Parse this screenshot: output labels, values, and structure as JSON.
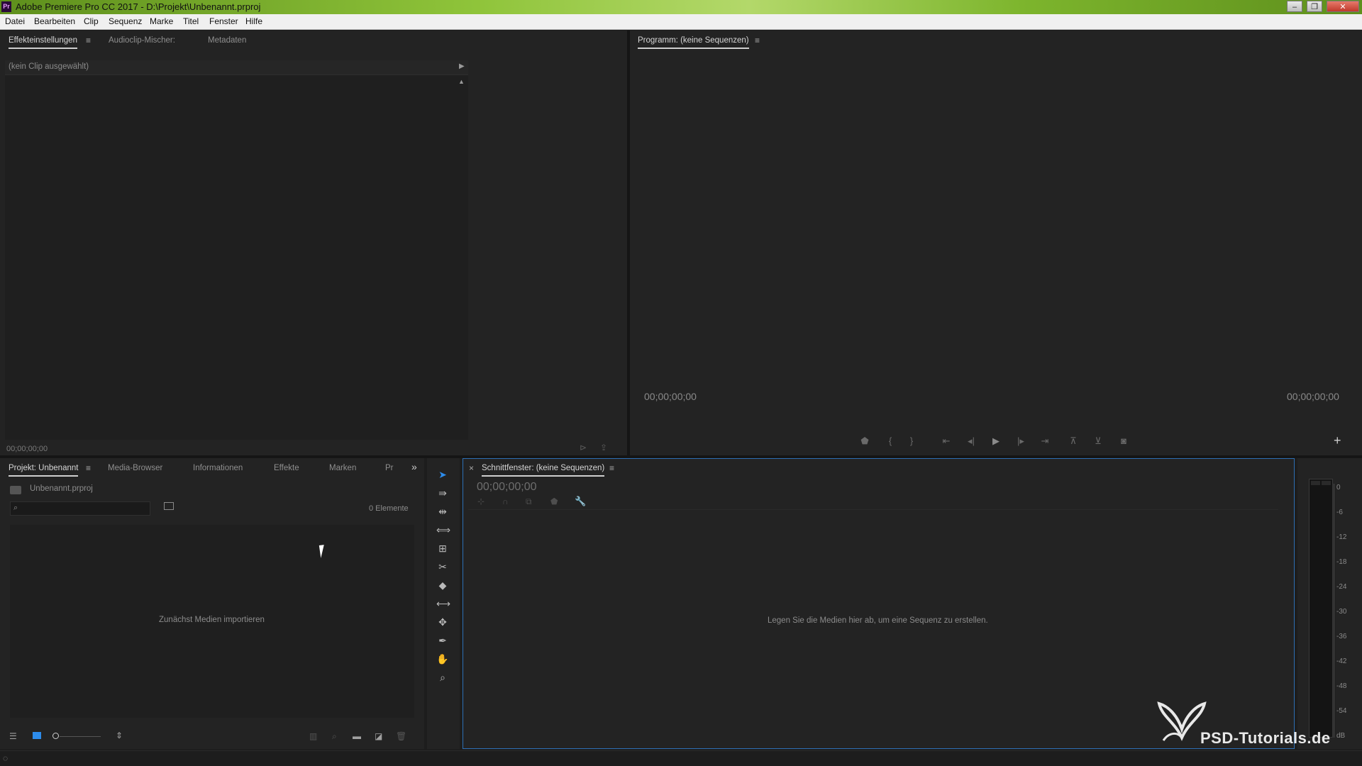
{
  "window": {
    "app_icon": "Pr",
    "title": "Adobe Premiere Pro CC 2017 - D:\\Projekt\\Unbenannt.prproj",
    "minimize_glyph": "–",
    "maximize_glyph": "❐",
    "close_glyph": "✕"
  },
  "menu": [
    "Datei",
    "Bearbeiten",
    "Clip",
    "Sequenz",
    "Marke",
    "Titel",
    "Fenster",
    "Hilfe"
  ],
  "effects_panel": {
    "tabs": [
      "Effekteinstellungen",
      "Audioclip-Mischer:",
      "Metadaten"
    ],
    "menu_glyph": "≡",
    "no_clip": "(kein Clip ausgewählt)",
    "timecode": "00;00;00;00"
  },
  "program_monitor": {
    "title": "Programm: (keine Sequenzen)",
    "menu_glyph": "≡",
    "timecode_left": "00;00;00;00",
    "timecode_right": "00;00;00;00",
    "add_glyph": "+",
    "controls": [
      "marker-icon",
      "mark-in-icon",
      "mark-out-icon",
      "go-to-in-icon",
      "step-back-icon",
      "play-icon",
      "step-forward-icon",
      "go-to-out-icon",
      "lift-icon",
      "extract-icon",
      "camera-icon"
    ]
  },
  "project_panel": {
    "tabs": [
      "Projekt: Unbenannt",
      "Media-Browser",
      "Informationen",
      "Effekte",
      "Marken",
      "Pr"
    ],
    "menu_glyph": "≡",
    "overflow_glyph": "»",
    "file_name": "Unbenannt.prproj",
    "search_placeholder": "",
    "item_count": "0 Elemente",
    "empty_message": "Zunächst Medien importieren"
  },
  "tools": [
    "selection-tool",
    "track-select-tool",
    "ripple-edit-tool",
    "rolling-edit-tool",
    "rate-stretch-tool",
    "razor-tool",
    "slip-tool",
    "slide-tool",
    "pen-tool",
    "hand-tool",
    "zoom-tool"
  ],
  "timeline": {
    "close_glyph": "×",
    "title": "Schnittfenster: (keine Sequenzen)",
    "menu_glyph": "≡",
    "timecode": "00;00;00;00",
    "empty_message": "Legen Sie die Medien hier ab, um eine Sequenz zu erstellen."
  },
  "audio_meter": {
    "labels": [
      "0",
      "-6",
      "-12",
      "-18",
      "-24",
      "-30",
      "-36",
      "-42",
      "-48",
      "-54",
      "dB"
    ]
  },
  "watermark": {
    "text": "PSD-Tutorials.de"
  }
}
